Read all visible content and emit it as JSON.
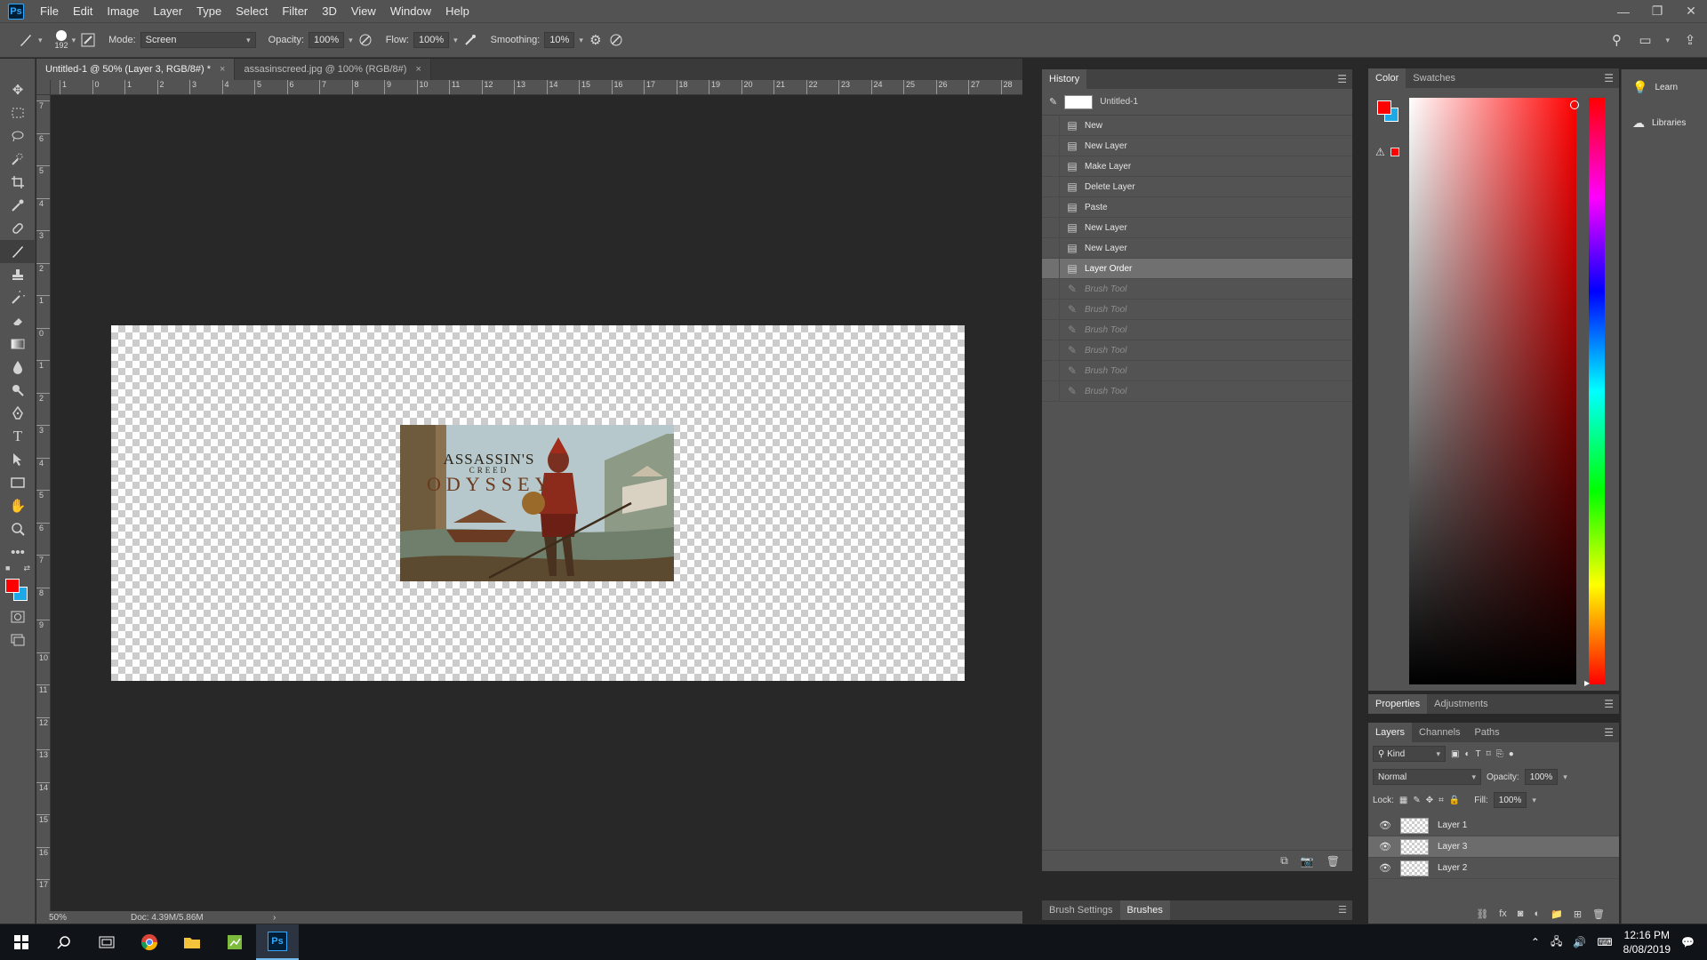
{
  "app": {
    "logo": "Ps"
  },
  "menu": [
    "File",
    "Edit",
    "Image",
    "Layer",
    "Type",
    "Select",
    "Filter",
    "3D",
    "View",
    "Window",
    "Help"
  ],
  "window_controls": {
    "minimize": "—",
    "restore": "❐",
    "close": "✕"
  },
  "options_bar": {
    "brush_size": "192",
    "mode_label": "Mode:",
    "mode_value": "Screen",
    "opacity_label": "Opacity:",
    "opacity_value": "100%",
    "flow_label": "Flow:",
    "flow_value": "100%",
    "smoothing_label": "Smoothing:",
    "smoothing_value": "10%"
  },
  "document_tabs": [
    {
      "label": "Untitled-1 @ 50% (Layer 3, RGB/8#) *",
      "close": "×"
    },
    {
      "label": "assasinscreed.jpg @ 100% (RGB/8#)",
      "close": "×"
    }
  ],
  "rulers": {
    "top": [
      "1",
      "0",
      "1",
      "2",
      "3",
      "4",
      "5",
      "6",
      "7",
      "8",
      "9",
      "10",
      "11",
      "12",
      "13",
      "14",
      "15",
      "16",
      "17",
      "18",
      "19",
      "20",
      "21",
      "22",
      "23",
      "24",
      "25",
      "26",
      "27",
      "28"
    ],
    "left": [
      "7",
      "6",
      "5",
      "4",
      "3",
      "2",
      "1",
      "0",
      "1",
      "2",
      "3",
      "4",
      "5",
      "6",
      "7",
      "8",
      "9",
      "10",
      "11",
      "12",
      "13",
      "14",
      "15",
      "16",
      "17"
    ]
  },
  "artwork": {
    "line1": "ASSASSIN'S",
    "line2": "CREED",
    "line3": "ODYSSEY"
  },
  "status_bar": {
    "zoom": "50%",
    "doc": "Doc: 4.39M/5.86M",
    "arrow": "›"
  },
  "history": {
    "tab": "History",
    "snapshot": "Untitled-1",
    "items": [
      {
        "label": "New",
        "state": "done"
      },
      {
        "label": "New Layer",
        "state": "done"
      },
      {
        "label": "Make Layer",
        "state": "done"
      },
      {
        "label": "Delete Layer",
        "state": "done"
      },
      {
        "label": "Paste",
        "state": "done"
      },
      {
        "label": "New Layer",
        "state": "done"
      },
      {
        "label": "New Layer",
        "state": "done"
      },
      {
        "label": "Layer Order",
        "state": "selected"
      },
      {
        "label": "Brush Tool",
        "state": "future"
      },
      {
        "label": "Brush Tool",
        "state": "future"
      },
      {
        "label": "Brush Tool",
        "state": "future"
      },
      {
        "label": "Brush Tool",
        "state": "future"
      },
      {
        "label": "Brush Tool",
        "state": "future"
      },
      {
        "label": "Brush Tool",
        "state": "future"
      }
    ]
  },
  "brush_tabs": [
    "Brush Settings",
    "Brushes"
  ],
  "color_panel": {
    "tabs": [
      "Color",
      "Swatches"
    ],
    "foreground": "#ff0000",
    "background": "#1ea8e6"
  },
  "dock": {
    "learn": "Learn",
    "libraries": "Libraries"
  },
  "properties_tabs": [
    "Properties",
    "Adjustments"
  ],
  "layers_panel": {
    "tabs": [
      "Layers",
      "Channels",
      "Paths"
    ],
    "kind_label": "Kind",
    "blend_mode": "Normal",
    "opacity_label": "Opacity:",
    "opacity_value": "100%",
    "lock_label": "Lock:",
    "fill_label": "Fill:",
    "fill_value": "100%",
    "layers": [
      {
        "name": "Layer 1",
        "selected": false
      },
      {
        "name": "Layer 3",
        "selected": true
      },
      {
        "name": "Layer 2",
        "selected": false
      }
    ]
  },
  "taskbar": {
    "time": "12:16 PM",
    "date": "8/08/2019",
    "ps_label": "Ps"
  }
}
